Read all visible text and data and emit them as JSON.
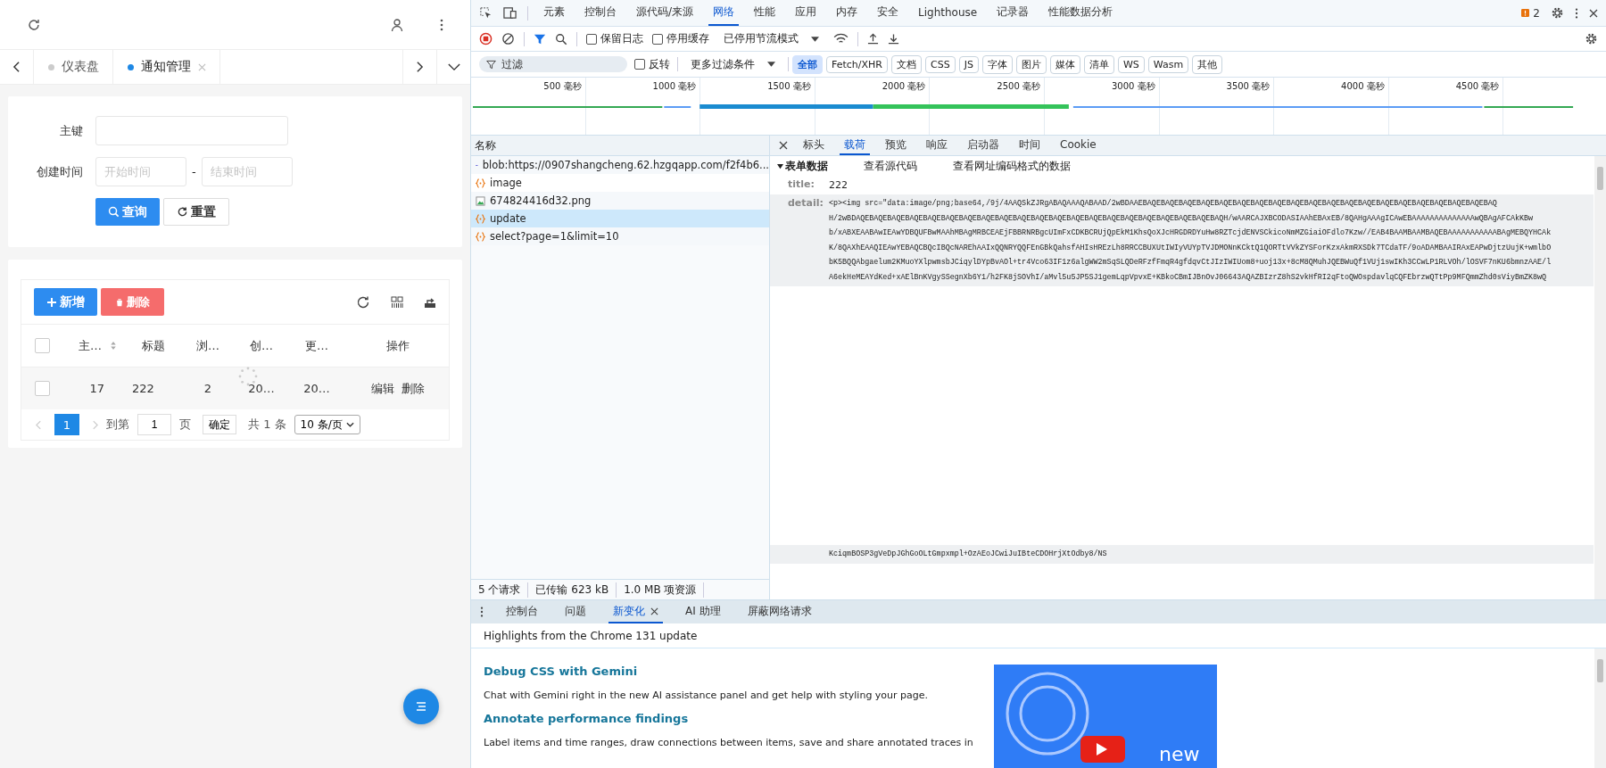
{
  "app": {
    "tabs": [
      {
        "label": "仪表盘",
        "selected": false,
        "closable": false
      },
      {
        "label": "通知管理",
        "selected": true,
        "closable": true
      }
    ],
    "form": {
      "key_label": "主键",
      "time_label": "创建时间",
      "start_placeholder": "开始时间",
      "separator": "-",
      "end_placeholder": "结束时间",
      "search_button": "查询",
      "reset_button": "重置"
    },
    "table": {
      "select_all_checked": false,
      "add_button": "新增",
      "delete_button": "删除",
      "columns": [
        {
          "label": "主…",
          "sortable": true
        },
        {
          "label": "标题",
          "sortable": false
        },
        {
          "label": "浏…",
          "sortable": false
        },
        {
          "label": "创…",
          "sortable": false
        },
        {
          "label": "更…",
          "sortable": false
        },
        {
          "label": "操作",
          "sortable": false
        }
      ],
      "rows": [
        {
          "checked": false,
          "cells": [
            "17",
            "222",
            "2",
            "20…",
            "20…"
          ],
          "actions": [
            "编辑",
            "删除"
          ]
        }
      ]
    },
    "pagination": {
      "pages": [
        {
          "label": "1",
          "selected": true
        }
      ],
      "goto_label": "到第",
      "page_value": "1",
      "page_unit": "页",
      "confirm": "确定",
      "total": "共 1 条",
      "page_size": "10 条/页"
    }
  },
  "devtools": {
    "panel_tabs": [
      {
        "label": "元素",
        "selected": false
      },
      {
        "label": "控制台",
        "selected": false
      },
      {
        "label": "源代码/来源",
        "selected": false
      },
      {
        "label": "网络",
        "selected": true
      },
      {
        "label": "性能",
        "selected": false
      },
      {
        "label": "应用",
        "selected": false
      },
      {
        "label": "内存",
        "selected": false
      },
      {
        "label": "安全",
        "selected": false
      },
      {
        "label": "Lighthouse",
        "selected": false
      },
      {
        "label": "记录器",
        "selected": false
      },
      {
        "label": "性能数据分析",
        "selected": false
      }
    ],
    "issues_count": "2",
    "toolbar": {
      "checkboxes": [
        {
          "label": "保留日志",
          "checked": false
        },
        {
          "label": "停用缓存",
          "checked": false
        }
      ],
      "throttle": "已停用节流模式"
    },
    "filter": {
      "placeholder": "过滤",
      "invert": {
        "label": "反转",
        "checked": false
      },
      "more": "更多过滤条件",
      "types": [
        {
          "label": "全部",
          "selected": true
        },
        {
          "label": "Fetch/XHR",
          "selected": false
        },
        {
          "label": "文档",
          "selected": false
        },
        {
          "label": "CSS",
          "selected": false
        },
        {
          "label": "JS",
          "selected": false
        },
        {
          "label": "字体",
          "selected": false
        },
        {
          "label": "图片",
          "selected": false
        },
        {
          "label": "媒体",
          "selected": false
        },
        {
          "label": "清单",
          "selected": false
        },
        {
          "label": "WS",
          "selected": false
        },
        {
          "label": "Wasm",
          "selected": false
        },
        {
          "label": "其他",
          "selected": false
        }
      ]
    },
    "timeline_ticks": [
      "500 毫秒",
      "1000 毫秒",
      "1500 毫秒",
      "2000 毫秒",
      "2500 毫秒",
      "3000 毫秒",
      "3500 毫秒",
      "4000 毫秒",
      "4500 毫秒"
    ],
    "name_header": "名称",
    "requests": [
      {
        "name": "blob:https://0907shangcheng.62.hzgqapp.com/f2f4b6...",
        "kind": "blob",
        "selected": false
      },
      {
        "name": "image",
        "kind": "xhr",
        "selected": false
      },
      {
        "name": "674824416d32.png",
        "kind": "image",
        "selected": false
      },
      {
        "name": "update",
        "kind": "xhr",
        "selected": true
      },
      {
        "name": "select?page=1&limit=10",
        "kind": "xhr",
        "selected": false
      }
    ],
    "detail_tabs": [
      {
        "label": "标头",
        "selected": false
      },
      {
        "label": "载荷",
        "selected": true
      },
      {
        "label": "预览",
        "selected": false
      },
      {
        "label": "响应",
        "selected": false
      },
      {
        "label": "启动器",
        "selected": false
      },
      {
        "label": "时间",
        "selected": false
      },
      {
        "label": "Cookie",
        "selected": false
      }
    ],
    "payload": {
      "section": "表单数据",
      "expanded": true,
      "view_source": "查看源代码",
      "view_url_encoded": "查看网址编码格式的数据",
      "fields": [
        {
          "key": "title:",
          "lines": [
            "222"
          ]
        },
        {
          "key": "detail:",
          "lines": [
            "<p><img src=\"data:image/png;base64,/9j/4AAQSkZJRgABAQAAAQABAAD/2wBDAAEBAQEBAQEBAQEBAQEBAQEBAQEBAQEBAQEBAQEBAQEBAQEBAQEBAQEBAQEBAQEBAQEBAQEBAQEBAQEBAQ",
            "H/2wBDAQEBAQEBAQEBAQEBAQEBAQEBAQEBAQEBAQEBAQEBAQEBAQEBAQEBAQEBAQEBAQEBAQEBAQEBAQEBAQEBAQH/wAARCAJXBCODASIAAhEBAxEB/8QAHgAAAgICAwEBAAAAAAAAAAAAAAwQBAgAFCAkKBw",
            "b/xABXEAABAwIEAwYDBQUFBwMAAhMBAgMRBCEAEjFBBRNRBgcUImFxCDKBCRUjQpEkM1KhsQoXJcHRGDRDYuHw8RZTcjdENVSCkicoNmMZGiaiOFdlo7Kzw//EAB4BAAMBAAMBAQEBAAAAAAAAAAABAgMEBQYHCAk",
            "K/8QAXhEAAQIEAwYEBAQCBQcIBQcNAREhAAIxQQNRYQQFEnGBkQahsfAHIsHREzLh8RRCCBUXUtIWIyVUYpTVJDMONnKCktQ1QORTtVVkZYSForKzxAkmRXSDk7TCdaTF/9oADAMBAAIRAxEAPwDjtzUujK+wmlbO",
            "bK5BQQAbgaelum2KMuoYXlpwmsbJCiqylDYpBvAOl+tr4Vco63IF1z6algWW2mSqSLQDeRFzfFmqR4gfdqvCtJIzIWIUom8+uoj13x+8cM8QMuhJQEBWuQf1VUj1swIKh3CCwLP1RLVOh/lOSVF7nKU6bmnzAAE/l",
            "A6ekHeMEAYdKed+xAElBnKVgySSegnXb6Y1/h2FK8jSOVhI/aMvl5u5JP5SJ1gemLqpVpvxE+KBkoCBmIJBnOvJ06643AQAZBIzrZ8hS2vkHfRI2qFtoQWOspdavlqCQFEbrzwQTtPp9MFQmmZhd0sViyBmZK8wQ"
          ]
        }
      ],
      "last_line": "KciqmBOSP3gVeDpJGhGoOLtGmpxmpl+OzAEoJCwiJuIBteCDOHrjXtOdby8/NS"
    },
    "status": [
      "5 个请求",
      "已传输 623 kB",
      "1.0 MB 项资源"
    ],
    "drawer_tabs": [
      {
        "label": "控制台",
        "selected": false,
        "closable": false
      },
      {
        "label": "问题",
        "selected": false,
        "closable": false
      },
      {
        "label": "新变化",
        "selected": true,
        "closable": true
      },
      {
        "label": "AI 助理",
        "selected": false,
        "closable": false
      },
      {
        "label": "屏蔽网络请求",
        "selected": false,
        "closable": false
      }
    ],
    "drawer_heading": "Highlights from the Chrome 131 update",
    "articles": [
      {
        "title": "Debug CSS with Gemini",
        "body": "Chat with Gemini right in the new AI assistance panel and get help with styling your page."
      },
      {
        "title": "Annotate performance findings",
        "body": "Label items and time ranges, draw connections between items, save and share annotated traces in"
      }
    ],
    "video_caption": "new"
  }
}
